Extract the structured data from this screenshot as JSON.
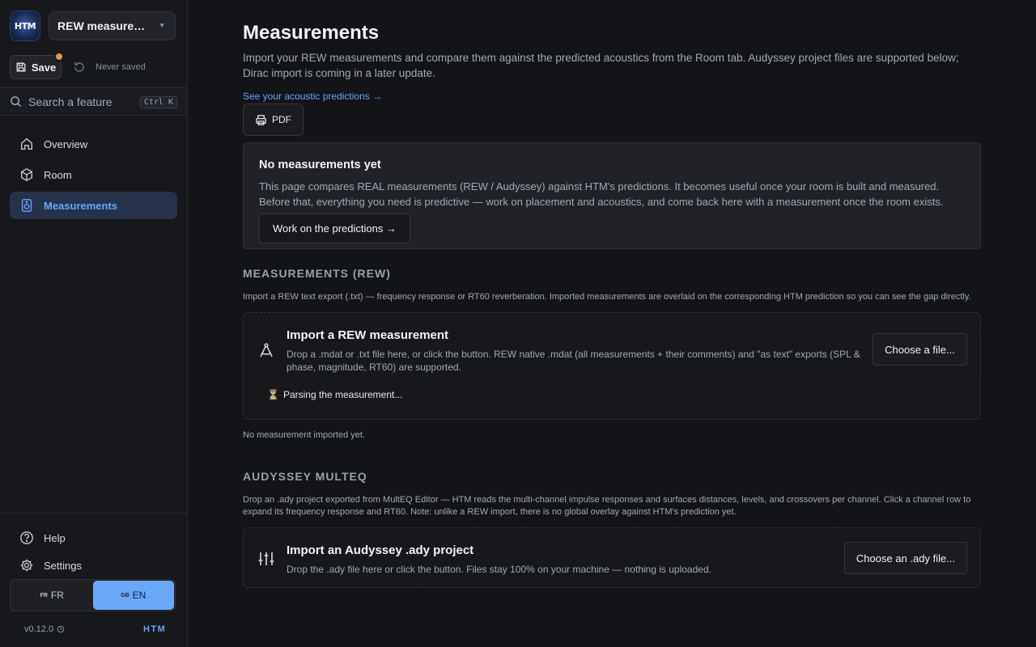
{
  "sidebar": {
    "logo_text": "HTM",
    "project_name": "REW measurem...",
    "save_label": "Save",
    "save_status": "Never saved",
    "search_placeholder": "Search a feature",
    "search_shortcut": "Ctrl K",
    "nav": [
      {
        "label": "Overview",
        "icon": "home-icon"
      },
      {
        "label": "Room",
        "icon": "cube-icon"
      },
      {
        "label": "Measurements",
        "icon": "speaker-icon",
        "active": true
      }
    ],
    "help_label": "Help",
    "settings_label": "Settings",
    "lang": [
      {
        "flag": "FR",
        "label": "FR"
      },
      {
        "flag": "GB",
        "label": "EN",
        "active": true
      }
    ],
    "version": "v0.12.0",
    "brand": "HTM"
  },
  "main": {
    "title": "Measurements",
    "description": "Import your REW measurements and compare them against the predicted acoustics from the Room tab. Audyssey project files are supported below; Dirac import is coming in a later update.",
    "predictions_link": "See your acoustic predictions →",
    "pdf_label": "PDF",
    "empty_state": {
      "title": "No measurements yet",
      "body": "This page compares REAL measurements (REW / Audyssey) against HTM's predictions. It becomes useful once your room is built and measured. Before that, everything you need is predictive — work on placement and acoustics, and come back here with a measurement once the room exists.",
      "button": "Work on the predictions →"
    },
    "rew": {
      "heading": "MEASUREMENTS (REW)",
      "description": "Import a REW text export (.txt) — frequency response or RT60 reverberation. Imported measurements are overlaid on the corresponding HTM prediction so you can see the gap directly.",
      "card_title": "Import a REW measurement",
      "card_desc": "Drop a .mdat or .txt file here, or click the button. REW native .mdat (all measurements + their comments) and \"as text\" exports (SPL & phase, magnitude, RT60) are supported.",
      "choose_label": "Choose a file...",
      "parsing": "Parsing the measurement...",
      "empty_note": "No measurement imported yet."
    },
    "audyssey": {
      "heading": "AUDYSSEY MULTEQ",
      "description": "Drop an .ady project exported from MultEQ Editor — HTM reads the multi-channel impulse responses and surfaces distances, levels, and crossovers per channel. Click a channel row to expand its frequency response and RT60. Note: unlike a REW import, there is no global overlay against HTM's prediction yet.",
      "card_title": "Import an Audyssey .ady project",
      "card_desc": "Drop the .ady file here or click the button. Files stay 100% on your machine — nothing is uploaded.",
      "choose_label": "Choose an .ady file..."
    }
  },
  "colors": {
    "accent": "#6aa3ff",
    "background": "#131417",
    "sidebar": "#17181c",
    "unsaved_dot": "#e39a3b"
  }
}
